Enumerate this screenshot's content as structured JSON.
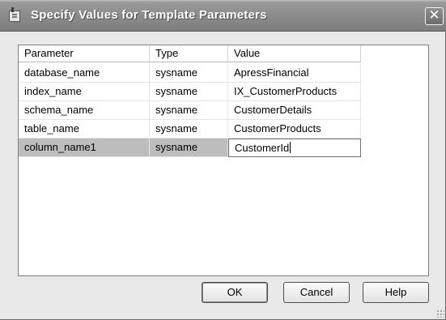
{
  "window": {
    "title": "Specify Values for Template Parameters",
    "close_glyph": "✕"
  },
  "grid": {
    "columns": [
      "Parameter",
      "Type",
      "Value"
    ],
    "rows": [
      {
        "parameter": "database_name",
        "type": "sysname",
        "value": "ApressFinancial"
      },
      {
        "parameter": "index_name",
        "type": "sysname",
        "value": "IX_CustomerProducts"
      },
      {
        "parameter": "schema_name",
        "type": "sysname",
        "value": "CustomerDetails"
      },
      {
        "parameter": "table_name",
        "type": "sysname",
        "value": "CustomerProducts"
      },
      {
        "parameter": "column_name1",
        "type": "sysname",
        "value": "CustomerId"
      }
    ],
    "selected_row": 4
  },
  "buttons": {
    "ok": "OK",
    "cancel": "Cancel",
    "help": "Help"
  },
  "icons": {
    "app": "template-parameters-app-icon",
    "close": "close-icon",
    "grip": "resize-grip-icon"
  }
}
